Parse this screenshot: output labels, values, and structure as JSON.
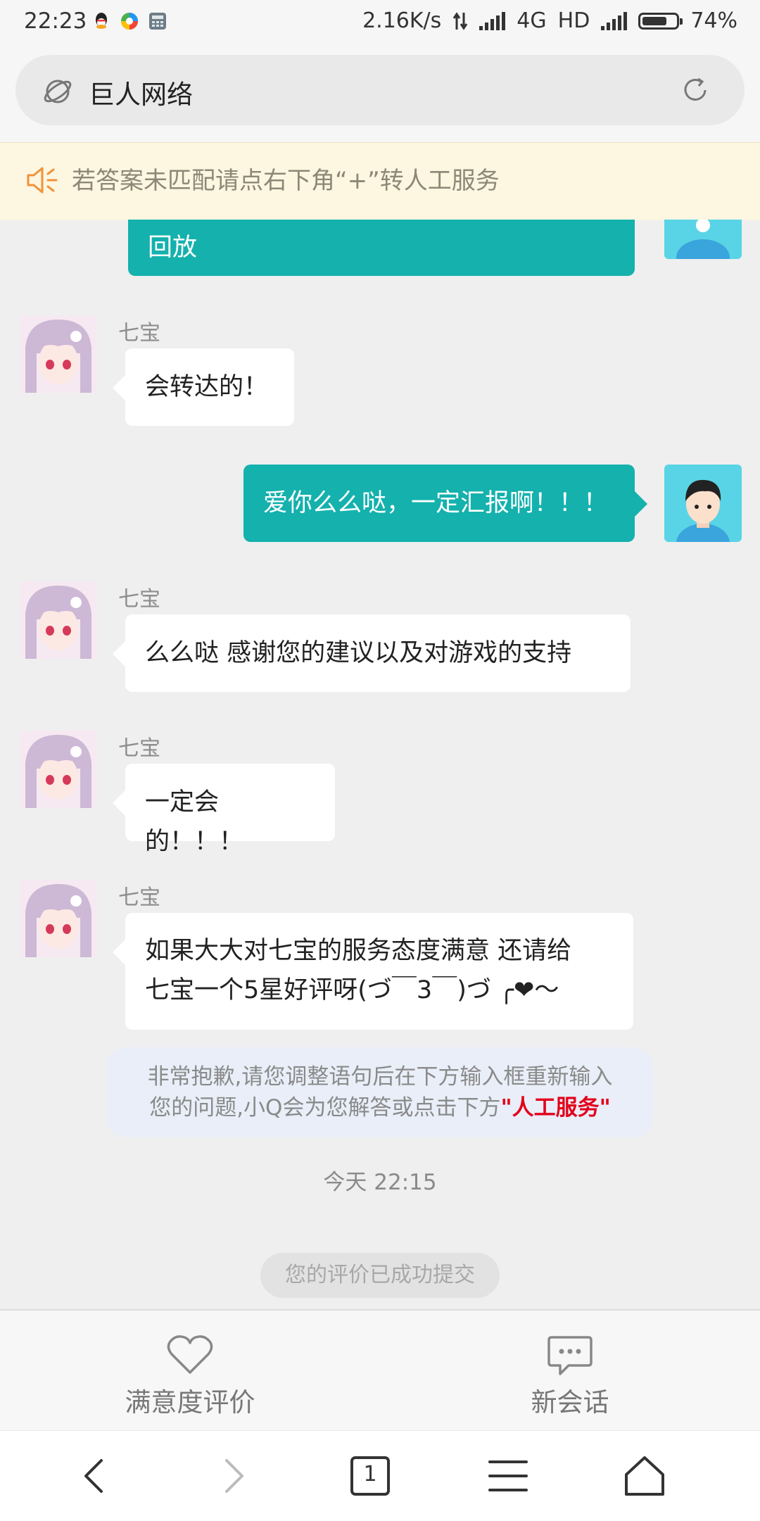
{
  "status_bar": {
    "time": "22:23",
    "speed": "2.16K/s",
    "network": "4G",
    "hd": "HD",
    "battery": "74%",
    "battery_level": 0.74
  },
  "browser": {
    "title": "巨人网络"
  },
  "notice": {
    "text": "若答案未匹配请点右下角“+”转人工服务"
  },
  "chat": {
    "messages": [
      {
        "from": "user",
        "text": "回放"
      },
      {
        "from": "bot",
        "name": "七宝",
        "text": "会转达的！"
      },
      {
        "from": "user",
        "text": "爱你么么哒，一定汇报啊！！！"
      },
      {
        "from": "bot",
        "name": "七宝",
        "text": "么么哒 感谢您的建议以及对游戏的支持"
      },
      {
        "from": "bot",
        "name": "七宝",
        "text": "一定会的！！！"
      },
      {
        "from": "bot",
        "name": "七宝",
        "line1": "如果大大对七宝的服务态度满意 还请给",
        "line2": "七宝一个5星好评呀(づ￣3￣)づ ╭❤～"
      }
    ],
    "system": {
      "line1": "非常抱歉,请您调整语句后在下方输入框重新输入",
      "line2_prefix": "您的问题,小Q会为您解答或点击下方",
      "line2_highlight": "\"人工服务\""
    },
    "timestamp": "今天 22:15",
    "rating_submitted": "您的评价已成功提交"
  },
  "actions": {
    "rate_label": "满意度评价",
    "new_chat_label": "新会话"
  },
  "nav": {
    "tab_count": "1"
  },
  "colors": {
    "user_bubble": "#14b1ad",
    "highlight": "#e3001b",
    "notice_bg": "#fdf6e0"
  }
}
